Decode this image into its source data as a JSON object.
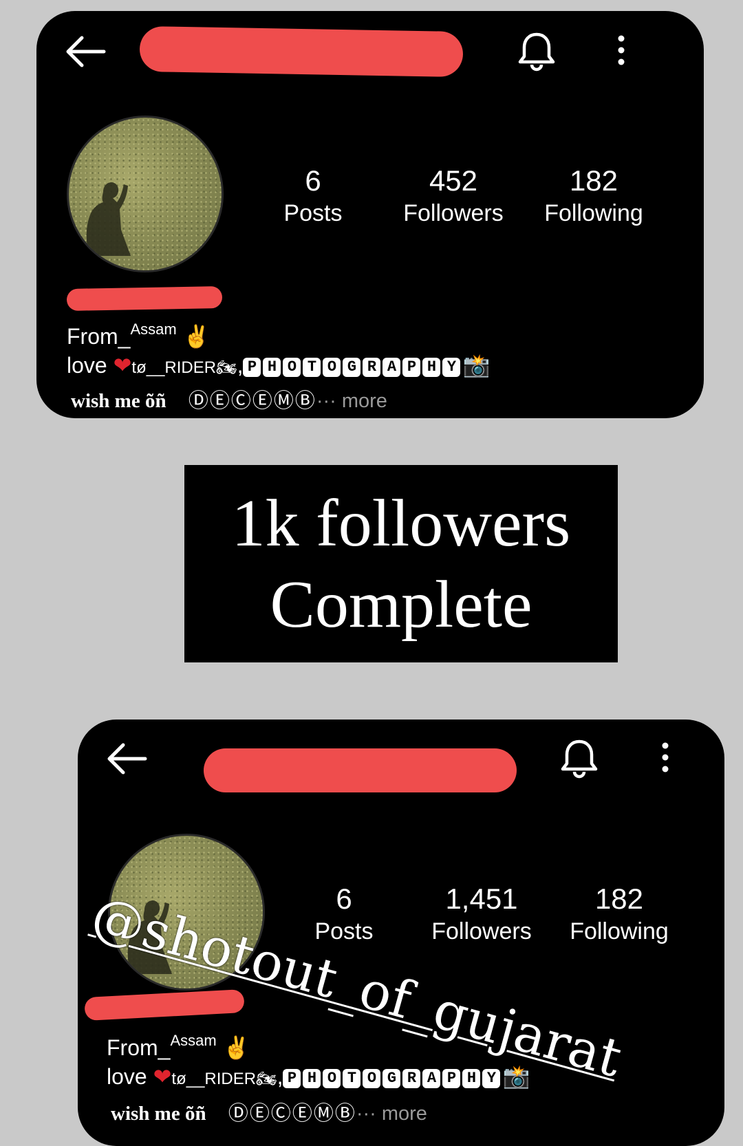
{
  "cards": [
    {
      "stats": [
        {
          "value": "6",
          "label": "Posts"
        },
        {
          "value": "452",
          "label": "Followers"
        },
        {
          "value": "182",
          "label": "Following"
        }
      ],
      "bio": {
        "from_prefix": "From_",
        "from_place": "Assam",
        "victory": "✌️",
        "love": "love ",
        "heart": "❤",
        "to_rider": "tø__RIDER",
        "rider_emoji": "🏍",
        "comma": ",",
        "photography": "PHOTOGRAPHY",
        "camera": "📸",
        "wish": "wish me õñ",
        "circled": "ⒹⒺⒸⒺⓂⒷ",
        "more": "··· more"
      }
    },
    {
      "stats": [
        {
          "value": "6",
          "label": "Posts"
        },
        {
          "value": "1,451",
          "label": "Followers"
        },
        {
          "value": "182",
          "label": "Following"
        }
      ],
      "bio": {
        "from_prefix": "From_",
        "from_place": "Assam",
        "victory": "✌️",
        "love": "love ",
        "heart": "❤",
        "to_rider": "tø__RIDER",
        "rider_emoji": "🏍",
        "comma": ",",
        "photography": "PHOTOGRAPHY",
        "camera": "📸",
        "wish": "wish me õñ",
        "circled": "ⒹⒺⒸⒺⓂⒷ",
        "more": "··· more"
      }
    }
  ],
  "banner": {
    "line1": "1k followers",
    "line2": "Complete"
  },
  "watermark": "@shotout_of_gujarat",
  "colors": {
    "redaction": "#ef4d4d",
    "background": "#c9c9c9",
    "card": "#000000",
    "heart": "#e0242e"
  },
  "icons": [
    "back-arrow-icon",
    "bell-icon",
    "more-vertical-icon"
  ]
}
